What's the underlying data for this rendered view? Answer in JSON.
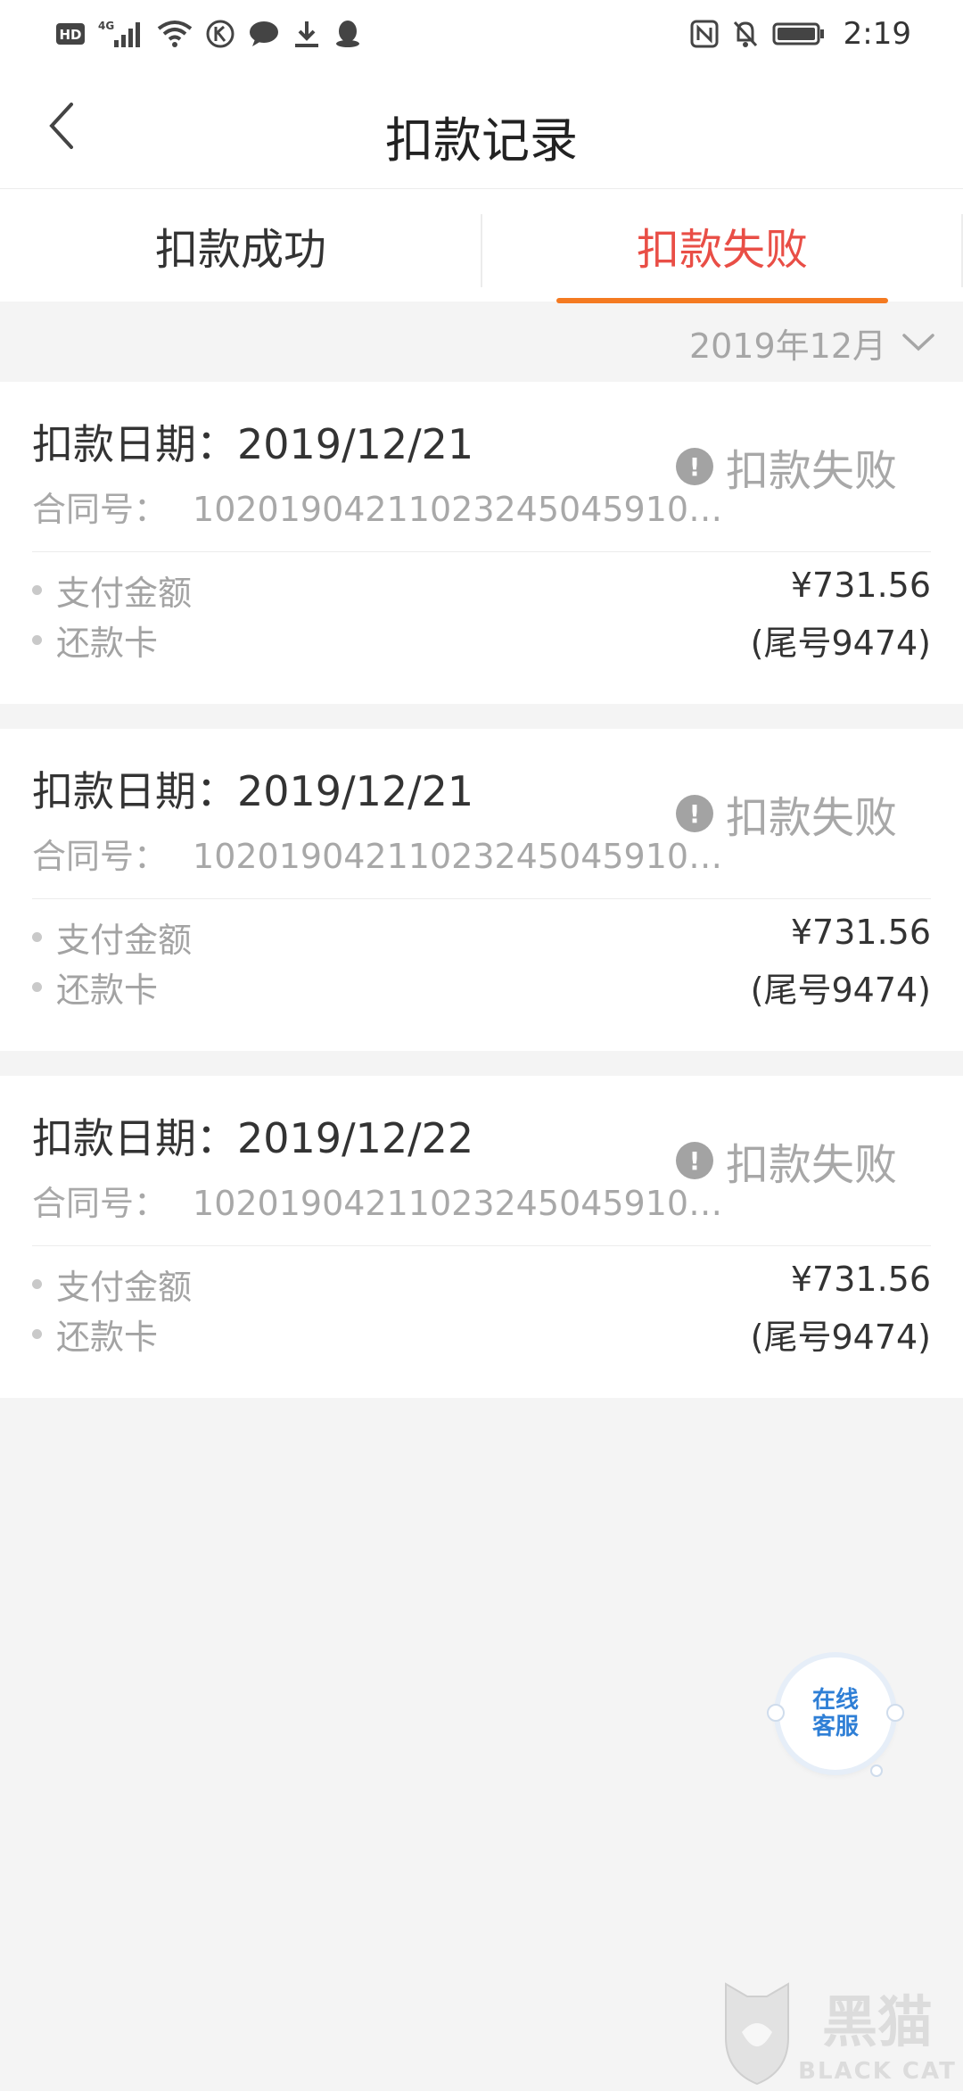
{
  "status_bar": {
    "left_icons": [
      "hd-icon",
      "4g-signal-icon",
      "wifi-icon",
      "k-icon",
      "message-icon",
      "download-icon",
      "qq-icon"
    ],
    "hd_text": "HD",
    "network_text": "4G",
    "right_icons": [
      "nfc-icon",
      "mute-bell-icon",
      "battery-icon"
    ],
    "time": "2:19"
  },
  "nav": {
    "title": "扣款记录",
    "back_icon": "chevron-left-icon"
  },
  "tabs": [
    {
      "label": "扣款成功",
      "active": false
    },
    {
      "label": "扣款失败",
      "active": true
    }
  ],
  "filter": {
    "month": "2019年12月",
    "icon": "chevron-down-icon"
  },
  "records": [
    {
      "date_label": "扣款日期：",
      "date": "2019/12/21",
      "contract_label": "合同号：",
      "contract_no": "10201904211023245045910…",
      "status": "扣款失败",
      "amount_label": "支付金额",
      "amount": "¥731.56",
      "card_label": "还款卡",
      "card": "(尾号9474)"
    },
    {
      "date_label": "扣款日期：",
      "date": "2019/12/21",
      "contract_label": "合同号：",
      "contract_no": "10201904211023245045910…",
      "status": "扣款失败",
      "amount_label": "支付金额",
      "amount": "¥731.56",
      "card_label": "还款卡",
      "card": "(尾号9474)"
    },
    {
      "date_label": "扣款日期：",
      "date": "2019/12/22",
      "contract_label": "合同号：",
      "contract_no": "10201904211023245045910…",
      "status": "扣款失败",
      "amount_label": "支付金额",
      "amount": "¥731.56",
      "card_label": "还款卡",
      "card": "(尾号9474)"
    }
  ],
  "online_service": {
    "line1": "在线",
    "line2": "客服"
  },
  "watermark": {
    "text_cn": "黑猫",
    "text_en": "BLACK CAT"
  },
  "colors": {
    "accent_red": "#e94e46",
    "underline_orange": "#f47a21",
    "service_blue": "#2f7fd6"
  }
}
